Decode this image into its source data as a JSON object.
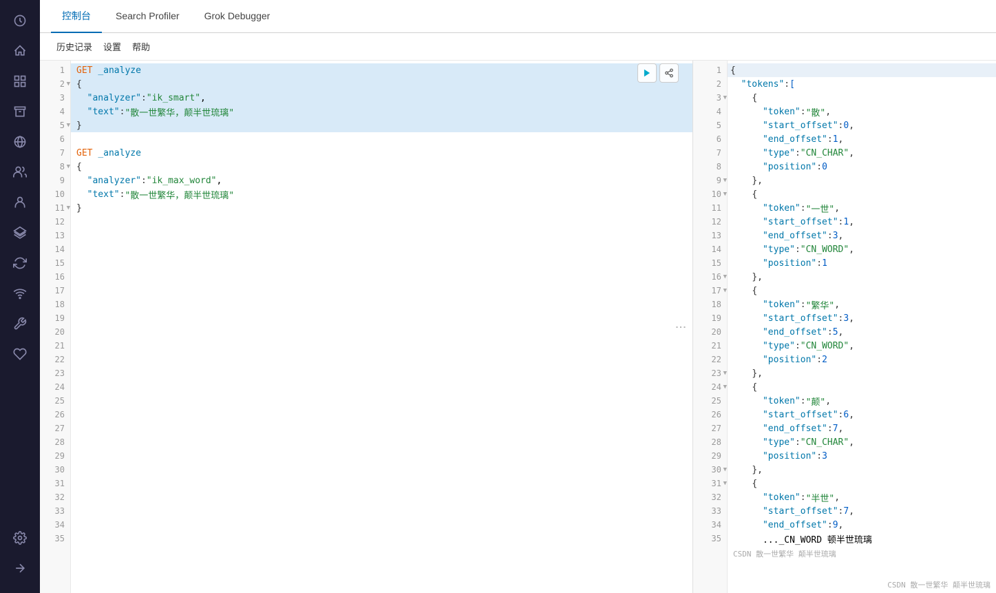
{
  "sidebar": {
    "icons": [
      {
        "name": "clock-icon",
        "glyph": "🕐",
        "active": false
      },
      {
        "name": "home-icon",
        "glyph": "⌂",
        "active": false
      },
      {
        "name": "grid-icon",
        "glyph": "▦",
        "active": false
      },
      {
        "name": "archive-icon",
        "glyph": "🗄",
        "active": false
      },
      {
        "name": "map-icon",
        "glyph": "◉",
        "active": false
      },
      {
        "name": "users-icon",
        "glyph": "⚙",
        "active": false
      },
      {
        "name": "person-icon",
        "glyph": "👤",
        "active": false
      },
      {
        "name": "layers-icon",
        "glyph": "📋",
        "active": false
      },
      {
        "name": "sync-icon",
        "glyph": "↻",
        "active": false
      },
      {
        "name": "wifi-icon",
        "glyph": "📡",
        "active": false
      },
      {
        "name": "wrench-icon",
        "glyph": "🔧",
        "active": false
      },
      {
        "name": "heart-icon",
        "glyph": "♡",
        "active": false
      },
      {
        "name": "gear-icon",
        "glyph": "⚙",
        "active": false
      }
    ],
    "bottom_icons": [
      {
        "name": "arrow-icon",
        "glyph": "⇒"
      }
    ]
  },
  "tabs": [
    {
      "label": "控制台",
      "active": true
    },
    {
      "label": "Search Profiler",
      "active": false
    },
    {
      "label": "Grok Debugger",
      "active": false
    }
  ],
  "menu": {
    "items": [
      "历史记录",
      "设置",
      "帮助"
    ]
  },
  "editor": {
    "lines": [
      {
        "num": 1,
        "content": "GET _analyze",
        "type": "method",
        "highlighted": true
      },
      {
        "num": 2,
        "content": "{",
        "type": "brace",
        "highlighted": true,
        "toggle": true
      },
      {
        "num": 3,
        "content": "  \"analyzer\": \"ik_smart\",",
        "type": "keyval",
        "highlighted": true
      },
      {
        "num": 4,
        "content": "  \"text\": \"散一世繁华，颠半世琉璃\"",
        "type": "keyval",
        "highlighted": true
      },
      {
        "num": 5,
        "content": "}",
        "type": "brace",
        "highlighted": true,
        "toggle": true
      },
      {
        "num": 6,
        "content": "",
        "type": "empty",
        "highlighted": false
      },
      {
        "num": 7,
        "content": "GET _analyze",
        "type": "method",
        "highlighted": false
      },
      {
        "num": 8,
        "content": "{",
        "type": "brace",
        "highlighted": false,
        "toggle": true
      },
      {
        "num": 9,
        "content": "  \"analyzer\": \"ik_max_word\",",
        "type": "keyval",
        "highlighted": false
      },
      {
        "num": 10,
        "content": "  \"text\": \"散一世繁华，颠半世琉璃\"",
        "type": "keyval",
        "highlighted": false
      },
      {
        "num": 11,
        "content": "}",
        "type": "brace",
        "highlighted": false,
        "toggle": true
      },
      {
        "num": 12,
        "content": "",
        "type": "empty"
      },
      {
        "num": 13,
        "content": "",
        "type": "empty"
      },
      {
        "num": 14,
        "content": "",
        "type": "empty"
      },
      {
        "num": 15,
        "content": "",
        "type": "empty"
      },
      {
        "num": 16,
        "content": "",
        "type": "empty"
      },
      {
        "num": 17,
        "content": "",
        "type": "empty"
      },
      {
        "num": 18,
        "content": "",
        "type": "empty"
      },
      {
        "num": 19,
        "content": "",
        "type": "empty"
      },
      {
        "num": 20,
        "content": "",
        "type": "empty"
      },
      {
        "num": 21,
        "content": "",
        "type": "empty"
      },
      {
        "num": 22,
        "content": "",
        "type": "empty"
      },
      {
        "num": 23,
        "content": "",
        "type": "empty"
      },
      {
        "num": 24,
        "content": "",
        "type": "empty"
      },
      {
        "num": 25,
        "content": "",
        "type": "empty"
      },
      {
        "num": 26,
        "content": "",
        "type": "empty"
      },
      {
        "num": 27,
        "content": "",
        "type": "empty"
      },
      {
        "num": 28,
        "content": "",
        "type": "empty"
      },
      {
        "num": 29,
        "content": "",
        "type": "empty"
      },
      {
        "num": 30,
        "content": "",
        "type": "empty"
      },
      {
        "num": 31,
        "content": "",
        "type": "empty"
      },
      {
        "num": 32,
        "content": "",
        "type": "empty"
      },
      {
        "num": 33,
        "content": "",
        "type": "empty"
      },
      {
        "num": 34,
        "content": "",
        "type": "empty"
      },
      {
        "num": 35,
        "content": "",
        "type": "empty"
      }
    ]
  },
  "result": {
    "lines": [
      {
        "num": 1,
        "content": "{",
        "highlighted": true
      },
      {
        "num": 2,
        "content": "  \"tokens\" : [",
        "highlighted": false
      },
      {
        "num": 3,
        "content": "    {",
        "highlighted": false,
        "toggle": true
      },
      {
        "num": 4,
        "content": "      \"token\" : \"散\",",
        "highlighted": false
      },
      {
        "num": 5,
        "content": "      \"start_offset\" : 0,",
        "highlighted": false
      },
      {
        "num": 6,
        "content": "      \"end_offset\" : 1,",
        "highlighted": false
      },
      {
        "num": 7,
        "content": "      \"type\" : \"CN_CHAR\",",
        "highlighted": false
      },
      {
        "num": 8,
        "content": "      \"position\" : 0",
        "highlighted": false
      },
      {
        "num": 9,
        "content": "    },",
        "highlighted": false,
        "toggle": true
      },
      {
        "num": 10,
        "content": "    {",
        "highlighted": false,
        "toggle": true
      },
      {
        "num": 11,
        "content": "      \"token\" : \"一世\",",
        "highlighted": false
      },
      {
        "num": 12,
        "content": "      \"start_offset\" : 1,",
        "highlighted": false
      },
      {
        "num": 13,
        "content": "      \"end_offset\" : 3,",
        "highlighted": false
      },
      {
        "num": 14,
        "content": "      \"type\" : \"CN_WORD\",",
        "highlighted": false
      },
      {
        "num": 15,
        "content": "      \"position\" : 1",
        "highlighted": false
      },
      {
        "num": 16,
        "content": "    },",
        "highlighted": false,
        "toggle": true
      },
      {
        "num": 17,
        "content": "    {",
        "highlighted": false,
        "toggle": true
      },
      {
        "num": 18,
        "content": "      \"token\" : \"繁华\",",
        "highlighted": false
      },
      {
        "num": 19,
        "content": "      \"start_offset\" : 3,",
        "highlighted": false
      },
      {
        "num": 20,
        "content": "      \"end_offset\" : 5,",
        "highlighted": false
      },
      {
        "num": 21,
        "content": "      \"type\" : \"CN_WORD\",",
        "highlighted": false
      },
      {
        "num": 22,
        "content": "      \"position\" : 2",
        "highlighted": false
      },
      {
        "num": 23,
        "content": "    },",
        "highlighted": false,
        "toggle": true
      },
      {
        "num": 24,
        "content": "    {",
        "highlighted": false,
        "toggle": true
      },
      {
        "num": 25,
        "content": "      \"token\" : \"颠\",",
        "highlighted": false
      },
      {
        "num": 26,
        "content": "      \"start_offset\" : 6,",
        "highlighted": false
      },
      {
        "num": 27,
        "content": "      \"end_offset\" : 7,",
        "highlighted": false
      },
      {
        "num": 28,
        "content": "      \"type\" : \"CN_CHAR\",",
        "highlighted": false
      },
      {
        "num": 29,
        "content": "      \"position\" : 3",
        "highlighted": false
      },
      {
        "num": 30,
        "content": "    },",
        "highlighted": false,
        "toggle": true
      },
      {
        "num": 31,
        "content": "    {",
        "highlighted": false,
        "toggle": true
      },
      {
        "num": 32,
        "content": "      \"token\" : \"半世\",",
        "highlighted": false
      },
      {
        "num": 33,
        "content": "      \"start_offset\" : 7,",
        "highlighted": false
      },
      {
        "num": 34,
        "content": "      \"end_offset\" : 9,",
        "highlighted": false
      },
      {
        "num": 35,
        "content": "      ..._CN_WORD 顿半世琉璃",
        "highlighted": false
      }
    ]
  },
  "actions": {
    "run_label": "▶",
    "settings_label": "⚙"
  },
  "watermark": "CSDN 散一世繁华 颠半世琉璃"
}
